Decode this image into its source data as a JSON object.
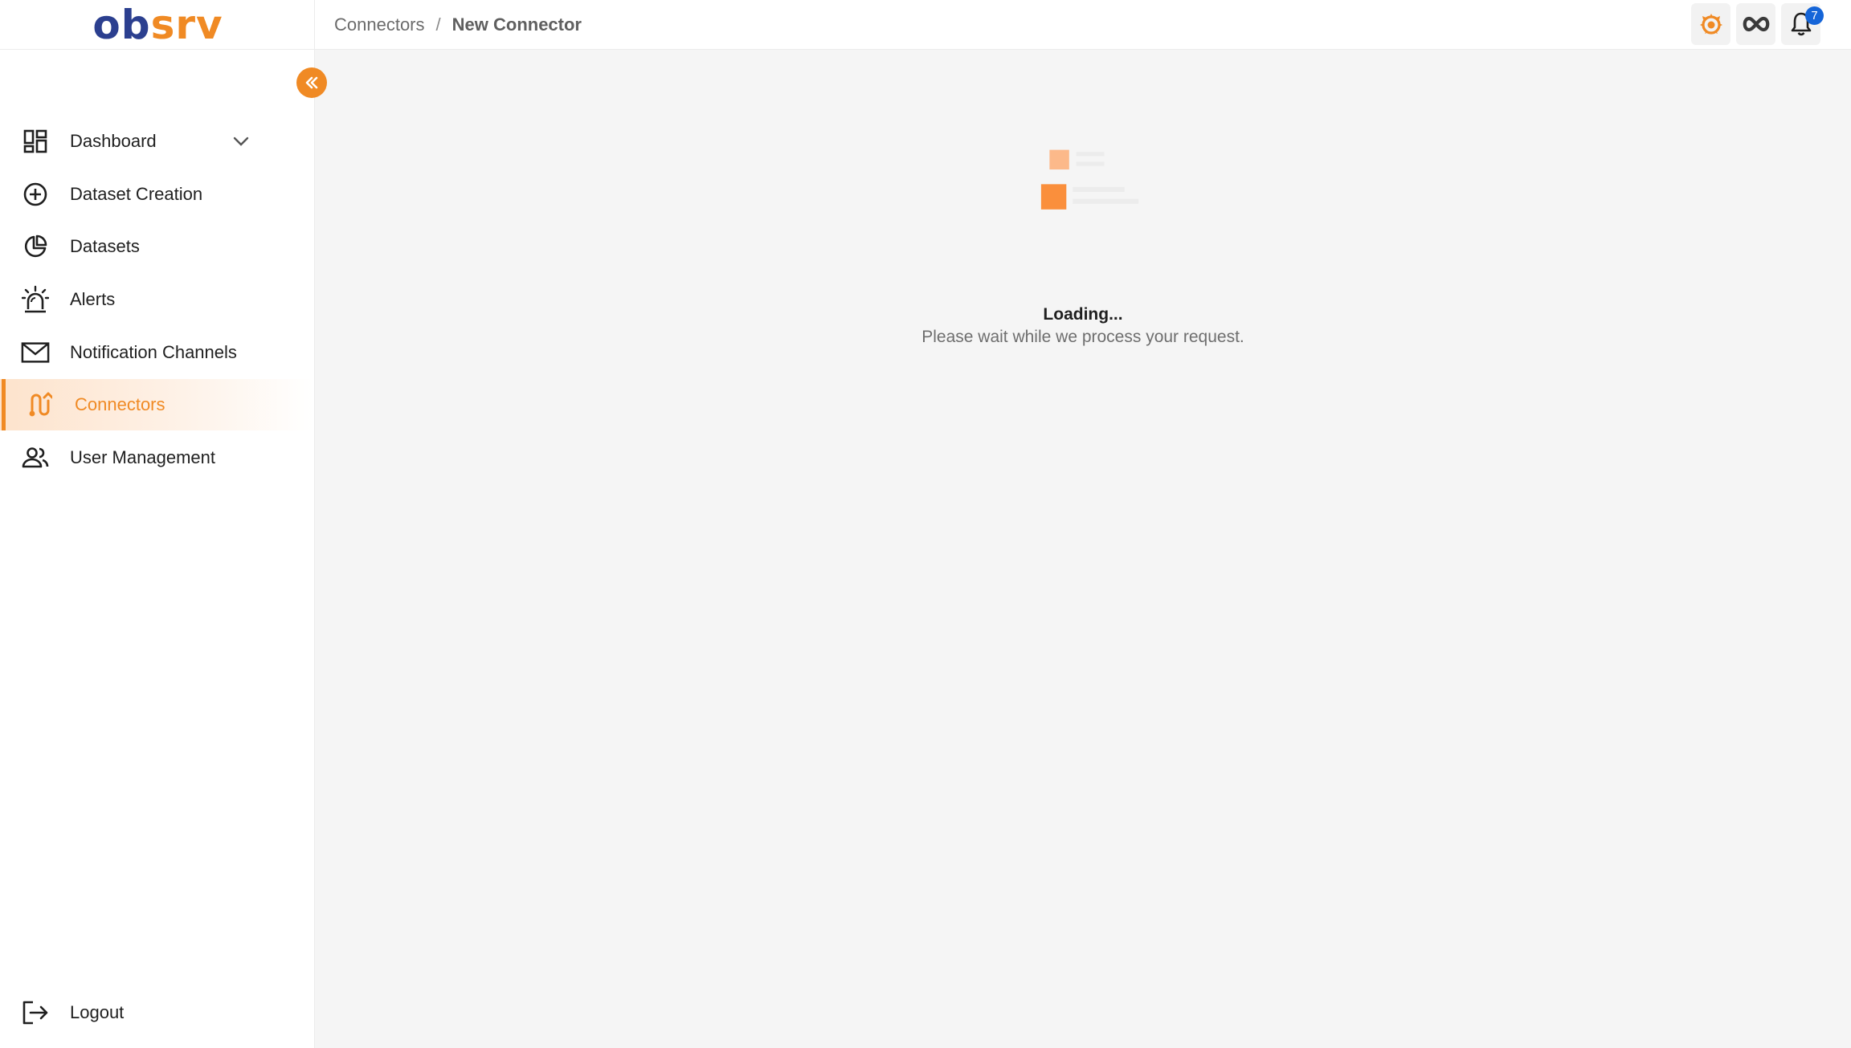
{
  "app": {
    "logo": {
      "part1": "ob",
      "part2": "srv"
    }
  },
  "breadcrumb": {
    "items": [
      "Connectors",
      "New Connector"
    ],
    "separator": "/"
  },
  "header": {
    "actions": [
      {
        "icon": "grafana-icon"
      },
      {
        "icon": "infinity-icon"
      },
      {
        "icon": "bell-icon",
        "badge": "7"
      }
    ]
  },
  "sidebar": {
    "items": [
      {
        "label": "Dashboard",
        "icon": "dashboard-icon",
        "has_chevron": true
      },
      {
        "label": "Dataset Creation",
        "icon": "plus-circle-icon"
      },
      {
        "label": "Datasets",
        "icon": "pie-chart-icon"
      },
      {
        "label": "Alerts",
        "icon": "siren-icon"
      },
      {
        "label": "Notification Channels",
        "icon": "mail-icon"
      },
      {
        "label": "Connectors",
        "icon": "connector-icon",
        "active": true
      },
      {
        "label": "User Management",
        "icon": "users-icon"
      }
    ],
    "logout": {
      "label": "Logout",
      "icon": "logout-icon"
    }
  },
  "main": {
    "loading_title": "Loading...",
    "loading_message": "Please wait while we process your request."
  },
  "colors": {
    "accent": "#f08a24",
    "brand_blue": "#2b3f8f",
    "badge_blue": "#1565d8"
  }
}
